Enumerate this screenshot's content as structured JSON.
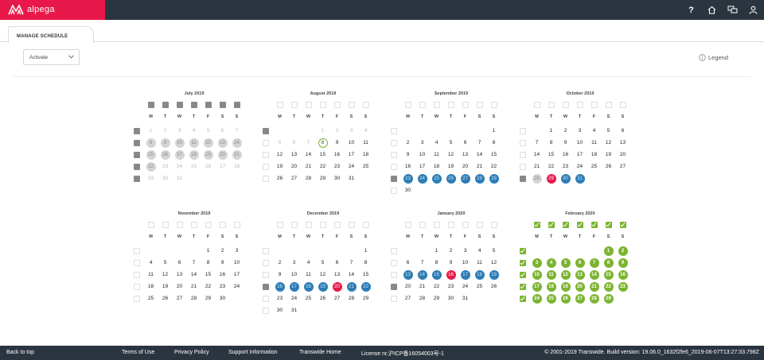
{
  "brand": {
    "name": "alpega"
  },
  "topbar": {
    "icons": [
      "help-icon",
      "home-icon",
      "chat-icon",
      "user-icon"
    ],
    "help_glyph": "?"
  },
  "tab": {
    "label": "MANAGE SCHEDULE"
  },
  "controls": {
    "action_select": "Activate",
    "legend_label": "Legend"
  },
  "weekdays": [
    "M",
    "T",
    "W",
    "T",
    "F",
    "S",
    "S"
  ],
  "colors": {
    "brand": "#e8194a",
    "topbar": "#2b353f",
    "blue": "#2d7db6",
    "green": "#7cb431",
    "red": "#e8194a",
    "grey": "#d4d4d4"
  },
  "months": [
    {
      "title": "July 2019",
      "offset": 0,
      "days": 31,
      "header_checkboxes": [
        "grey",
        "grey",
        "grey",
        "grey",
        "grey",
        "grey",
        "grey"
      ],
      "week_checkboxes": [
        "grey",
        "grey",
        "grey",
        "grey",
        "grey"
      ],
      "disabled": "all",
      "marked": {
        "8": "grey",
        "9": "grey",
        "10": "grey",
        "11": "grey",
        "12": "grey",
        "13": "grey",
        "14": "grey",
        "15": "grey",
        "16": "grey",
        "17": "grey",
        "18": "grey",
        "19": "grey",
        "20": "grey",
        "21": "grey",
        "22": "grey"
      }
    },
    {
      "title": "August 2019",
      "offset": 3,
      "days": 31,
      "header_checkboxes": [
        "empty",
        "empty",
        "empty",
        "empty",
        "empty",
        "empty",
        "empty"
      ],
      "week_checkboxes": [
        "grey",
        "empty",
        "empty",
        "empty",
        "empty"
      ],
      "disabled": [
        1,
        2,
        3,
        4,
        5,
        6,
        7
      ],
      "marked": {
        "8": "today"
      }
    },
    {
      "title": "September 2019",
      "offset": 6,
      "days": 30,
      "header_checkboxes": [
        "empty",
        "empty",
        "empty",
        "empty",
        "empty",
        "empty",
        "empty"
      ],
      "week_checkboxes": [
        "empty",
        "empty",
        "empty",
        "empty",
        "grey",
        "empty"
      ],
      "disabled": [],
      "marked": {
        "23": "blue",
        "24": "blue",
        "25": "blue",
        "26": "blue",
        "27": "blue",
        "28": "blue",
        "29": "blue"
      }
    },
    {
      "title": "October 2019",
      "offset": 1,
      "days": 31,
      "header_checkboxes": [
        "empty",
        "empty",
        "empty",
        "empty",
        "empty",
        "empty",
        "empty"
      ],
      "week_checkboxes": [
        "empty",
        "empty",
        "empty",
        "empty",
        "grey"
      ],
      "disabled": [],
      "marked": {
        "28": "grey",
        "29": "red",
        "30": "blue",
        "31": "blue"
      }
    },
    {
      "title": "November 2019",
      "offset": 4,
      "days": 30,
      "header_checkboxes": [
        "empty",
        "empty",
        "empty",
        "empty",
        "empty",
        "empty",
        "empty"
      ],
      "week_checkboxes": [
        "empty",
        "empty",
        "empty",
        "empty",
        "empty"
      ],
      "disabled": [],
      "marked": {}
    },
    {
      "title": "December 2019",
      "offset": 6,
      "days": 31,
      "header_checkboxes": [
        "empty",
        "empty",
        "empty",
        "empty",
        "empty",
        "empty",
        "empty"
      ],
      "week_checkboxes": [
        "empty",
        "empty",
        "empty",
        "grey",
        "empty",
        "empty"
      ],
      "disabled": [],
      "marked": {
        "16": "blue",
        "17": "blue",
        "18": "blue",
        "19": "blue",
        "20": "red",
        "21": "blue",
        "22": "blue"
      }
    },
    {
      "title": "January 2020",
      "offset": 2,
      "days": 31,
      "header_checkboxes": [
        "empty",
        "empty",
        "empty",
        "empty",
        "empty",
        "empty",
        "empty"
      ],
      "week_checkboxes": [
        "empty",
        "empty",
        "empty",
        "grey",
        "empty"
      ],
      "disabled": [],
      "marked": {
        "13": "blue",
        "14": "blue",
        "15": "blue",
        "16": "red",
        "17": "blue",
        "18": "blue",
        "19": "blue"
      }
    },
    {
      "title": "February 2020",
      "offset": 5,
      "days": 29,
      "header_checkboxes": [
        "green",
        "green",
        "green",
        "green",
        "green",
        "green",
        "green"
      ],
      "week_checkboxes": [
        "green",
        "green",
        "green",
        "green",
        "green"
      ],
      "disabled": [],
      "marked": {
        "all": "green"
      }
    }
  ],
  "footer": {
    "back_to_top": "Back to top",
    "links": [
      "Terms of Use",
      "Privacy Policy",
      "Support Information",
      "Transwide Home"
    ],
    "license": "License nr.沪ICP备16054003号-1",
    "copyright": "© 2001-2019 Transwide. Build version: 19.06.0_1632f2fe6_2019-06-07T13:27:33.798Z"
  }
}
